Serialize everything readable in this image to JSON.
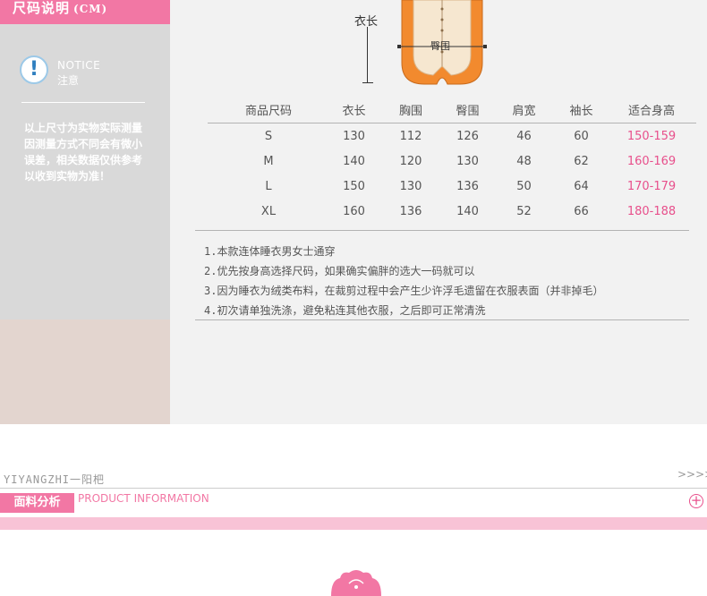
{
  "header": {
    "title": "尺码说明",
    "unit": "(CM)"
  },
  "notice": {
    "title_en": "NOTICE",
    "title_cn": "注意",
    "description": "以上尺寸为实物实际测量因测量方式不同会有微小误差，相关数据仅供参考以收到实物为准！"
  },
  "diagram": {
    "length_label": "衣长",
    "hip_label": "臀围"
  },
  "size_table": {
    "headers": [
      "商品尺码",
      "衣长",
      "胸围",
      "臀围",
      "肩宽",
      "袖长",
      "适合身高"
    ],
    "rows": [
      [
        "S",
        "130",
        "112",
        "126",
        "46",
        "60",
        "150-159"
      ],
      [
        "M",
        "140",
        "120",
        "130",
        "48",
        "62",
        "160-169"
      ],
      [
        "L",
        "150",
        "130",
        "136",
        "50",
        "64",
        "170-179"
      ],
      [
        "XL",
        "160",
        "136",
        "140",
        "52",
        "66",
        "180-188"
      ]
    ],
    "highlight_color": "#e8508c"
  },
  "notes": [
    "1.本款连体睡衣男女士通穿",
    "2.优先按身高选择尺码，如果确实偏胖的选大一码就可以",
    "3.因为睡衣为绒类布料，在裁剪过程中会产生少许浮毛遗留在衣服表面（并非掉毛）",
    "4.初次请单独洗涤，避免粘连其他衣服，之后即可正常清洗"
  ],
  "section": {
    "brand": "YIYANGZHI一阳杷",
    "arrows": ">>>>",
    "tab_label": "面料分析",
    "title_en": "PRODUCT INFORMATION",
    "plus_icon": "plus-circle-icon"
  },
  "colors": {
    "accent": "#f277a4",
    "sidebar": "#d9d9d9",
    "garment": "#f28a2e"
  }
}
